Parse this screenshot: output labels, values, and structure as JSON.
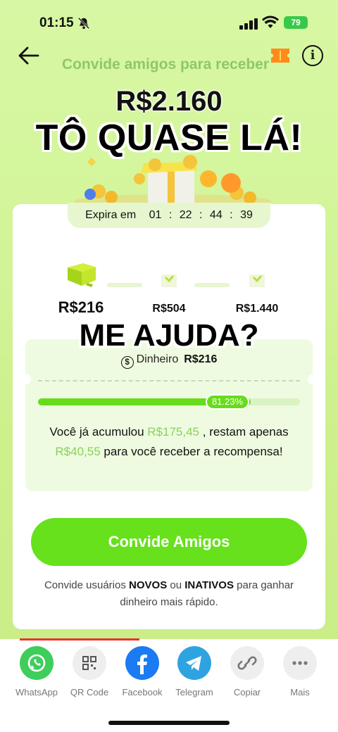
{
  "status_bar": {
    "time": "01:15",
    "battery": "79"
  },
  "header": {
    "title": "Convide amigos para receber"
  },
  "headline": {
    "amount": "R$2.160",
    "caption": "TÔ QUASE LÁ!"
  },
  "expiry": {
    "label": "Expira em",
    "hours": "01",
    "minutes": "22",
    "seconds": "44",
    "centis": "39"
  },
  "milestones": [
    {
      "value": "R$216"
    },
    {
      "value": "R$504"
    },
    {
      "value": "R$1.440"
    }
  ],
  "overlay_caption": "ME AJUDA?",
  "cash": {
    "label": "Dinheiro",
    "amount": "R$216"
  },
  "progress": {
    "fraction": 0.8123,
    "percent_label": "81.23%",
    "msg_prefix": "Você já acumulou",
    "accumulated": "R$175,45",
    "msg_mid": ", restam apenas",
    "remaining": "R$40,55",
    "msg_suffix": "para você receber a recompensa!"
  },
  "invite": {
    "button_label": "Convide Amigos",
    "note_1": "Convide usuários",
    "note_new": "NOVOS",
    "note_or": "ou",
    "note_inactive": "INATIVOS",
    "note_2": "para ganhar dinheiro mais rápido."
  },
  "share": [
    {
      "label": "WhatsApp",
      "icon": "whatsapp-icon",
      "color": "#3fcd5b"
    },
    {
      "label": "QR Code",
      "icon": "qr-code-icon",
      "color": "#eeeeee"
    },
    {
      "label": "Facebook",
      "icon": "facebook-icon",
      "color": "#1b7bf2"
    },
    {
      "label": "Telegram",
      "icon": "telegram-icon",
      "color": "#2fa3e0"
    },
    {
      "label": "Copiar",
      "icon": "link-icon",
      "color": "#eeeeee"
    },
    {
      "label": "Mais",
      "icon": "more-icon",
      "color": "#eeeeee"
    }
  ],
  "colors": {
    "accent": "#66e11c",
    "highlight": "#8cd05a"
  }
}
